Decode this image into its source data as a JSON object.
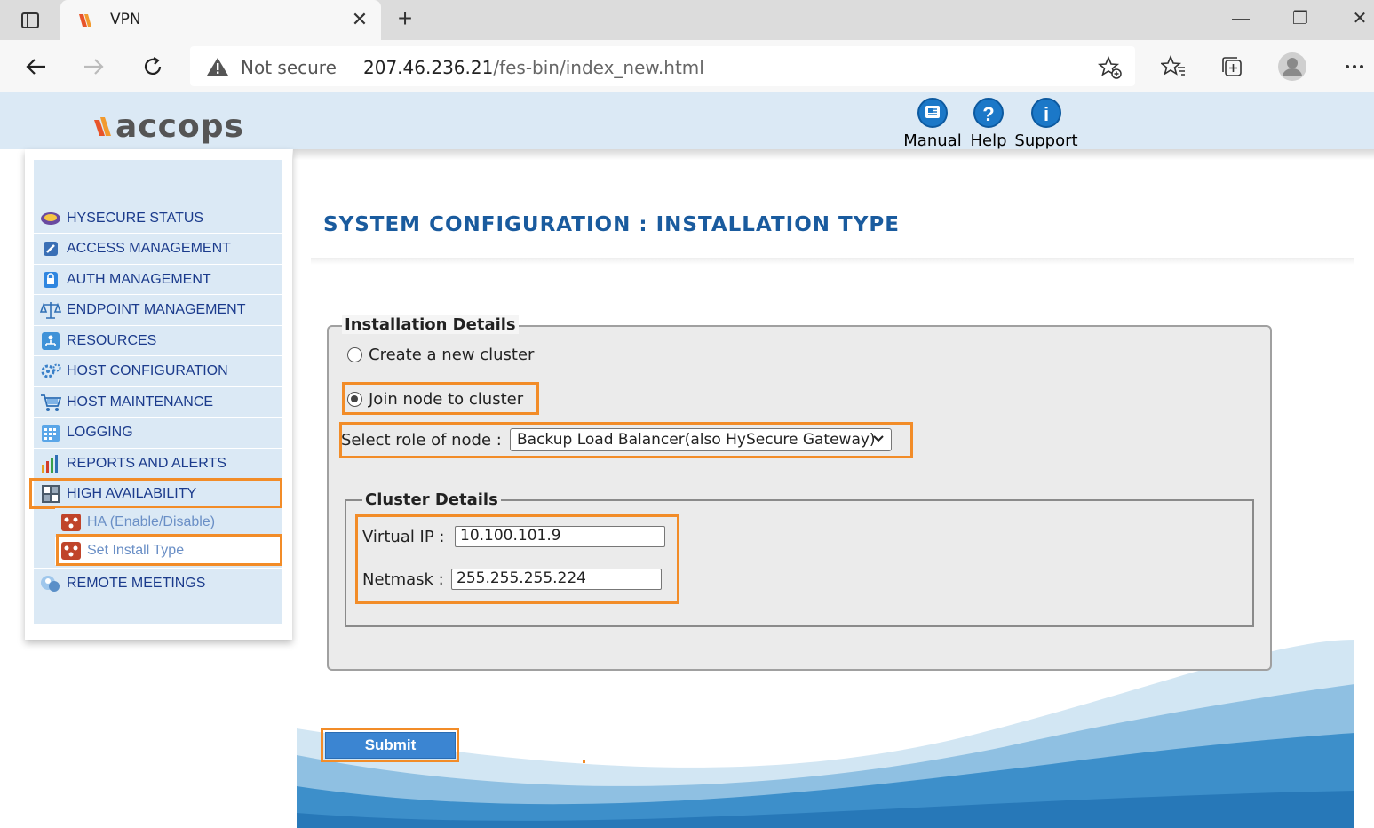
{
  "browser": {
    "tab_title": "VPN",
    "not_secure": "Not secure",
    "url_host": "207.46.236.21",
    "url_path": "/fes-bin/index_new.html",
    "tab_close": "✕",
    "new_tab": "+",
    "win_minimize": "—",
    "win_restore": "❐",
    "win_close": "✕"
  },
  "header": {
    "logo_text": "accops",
    "links": {
      "manual": "Manual",
      "help": "Help",
      "support": "Support"
    }
  },
  "sidebar": {
    "items": [
      {
        "label": "HYSECURE STATUS",
        "icon": "status-icon"
      },
      {
        "label": "ACCESS MANAGEMENT",
        "icon": "shield-icon"
      },
      {
        "label": "AUTH MANAGEMENT",
        "icon": "lock-icon"
      },
      {
        "label": "ENDPOINT MANAGEMENT",
        "icon": "scales-icon"
      },
      {
        "label": "RESOURCES",
        "icon": "network-icon"
      },
      {
        "label": "HOST CONFIGURATION",
        "icon": "gear-icon"
      },
      {
        "label": "HOST MAINTENANCE",
        "icon": "cart-icon"
      },
      {
        "label": "LOGGING",
        "icon": "calendar-icon"
      },
      {
        "label": "REPORTS AND ALERTS",
        "icon": "bar-chart-icon"
      },
      {
        "label": "HIGH AVAILABILITY",
        "icon": "cluster-icon"
      }
    ],
    "subitems": [
      {
        "label": "HA (Enable/Disable)",
        "icon": "ha-icon"
      },
      {
        "label": "Set Install Type",
        "icon": "ha-icon"
      }
    ],
    "last_item": {
      "label": "REMOTE MEETINGS",
      "icon": "meeting-icon"
    }
  },
  "main": {
    "title": "SYSTEM CONFIGURATION : INSTALLATION TYPE",
    "installation_legend": "Installation Details",
    "option_create": "Create a new cluster",
    "option_join": "Join node to cluster",
    "selected_option": "join",
    "role_label": "Select role of node :",
    "role_value": "Backup Load Balancer(also HySecure Gateway)",
    "cluster_legend": "Cluster Details",
    "virtual_ip_label": "Virtual IP :",
    "virtual_ip_value": "10.100.101.9",
    "netmask_label": "Netmask :",
    "netmask_value": "255.255.255.224",
    "submit_label": "Submit"
  },
  "colors": {
    "highlight": "#f28c28",
    "title_blue": "#1a5b9e",
    "nav_text": "#1b3b8c",
    "header_bg": "#dbe9f5",
    "button_blue": "#3b85d2"
  }
}
